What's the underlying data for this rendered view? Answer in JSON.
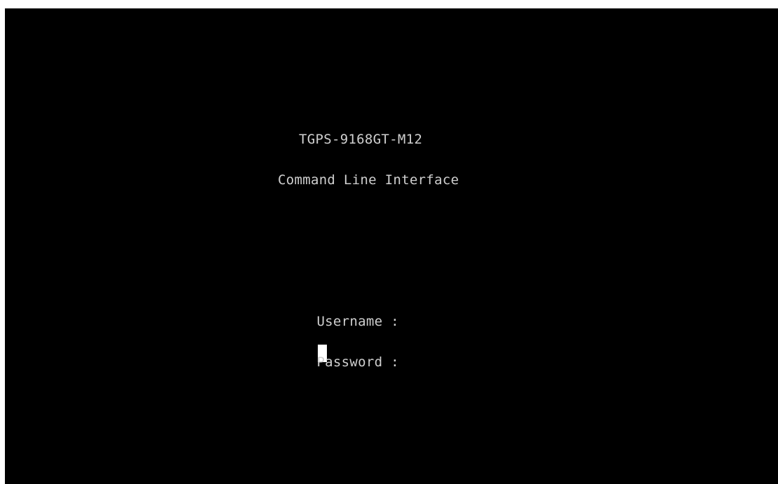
{
  "terminal": {
    "device_name": "TGPS-9168GT-M12",
    "subtitle": "Command Line Interface",
    "login": {
      "username_label": "Username :",
      "username_value": "",
      "password_label": "Password :",
      "password_value": ""
    }
  },
  "colors": {
    "background": "#000000",
    "text": "#cfcfcf",
    "cursor": "#ffffff"
  }
}
